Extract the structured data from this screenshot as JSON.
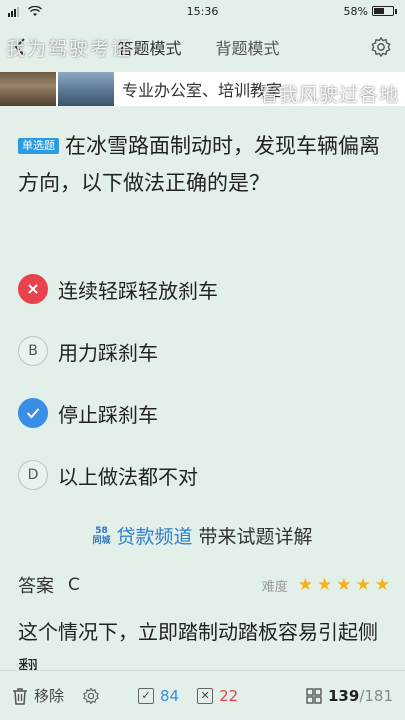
{
  "status_bar": {
    "time": "15:36",
    "battery": "58%",
    "battery_level": 0.58
  },
  "nav": {
    "back_icon": "chevron-left-icon",
    "tab_answer": "答题模式",
    "tab_memorize": "背题模式",
    "settings_icon": "gear-icon"
  },
  "watermarks": {
    "top_left": "我为驾驶考证",
    "top_right": "看我风驶过各地"
  },
  "ad": {
    "text": "专业办公室、培训教室"
  },
  "question": {
    "type": "单选题",
    "text": "在冰雪路面制动时，发现车辆偏离方向，以下做法正确的是？"
  },
  "options": [
    {
      "key": "A",
      "text": "连续轻踩轻放刹车",
      "state": "wrong"
    },
    {
      "key": "B",
      "text": "用力踩刹车",
      "state": "normal"
    },
    {
      "key": "C",
      "text": "停止踩刹车",
      "state": "right"
    },
    {
      "key": "D",
      "text": "以上做法都不对",
      "state": "normal"
    }
  ],
  "sponsor": {
    "logo_top": "58",
    "logo_bottom": "同城",
    "link": "贷款频道",
    "text": "带来试题详解"
  },
  "answer": {
    "label": "答案",
    "value": "C",
    "difficulty_label": "难度",
    "stars": 5
  },
  "explanation": "这个情况下，立即踏制动踏板容易引起侧翻",
  "bottom": {
    "remove_label": "移除",
    "right_count": "84",
    "wrong_count": "22",
    "progress_current": "139",
    "progress_total": "/181"
  }
}
